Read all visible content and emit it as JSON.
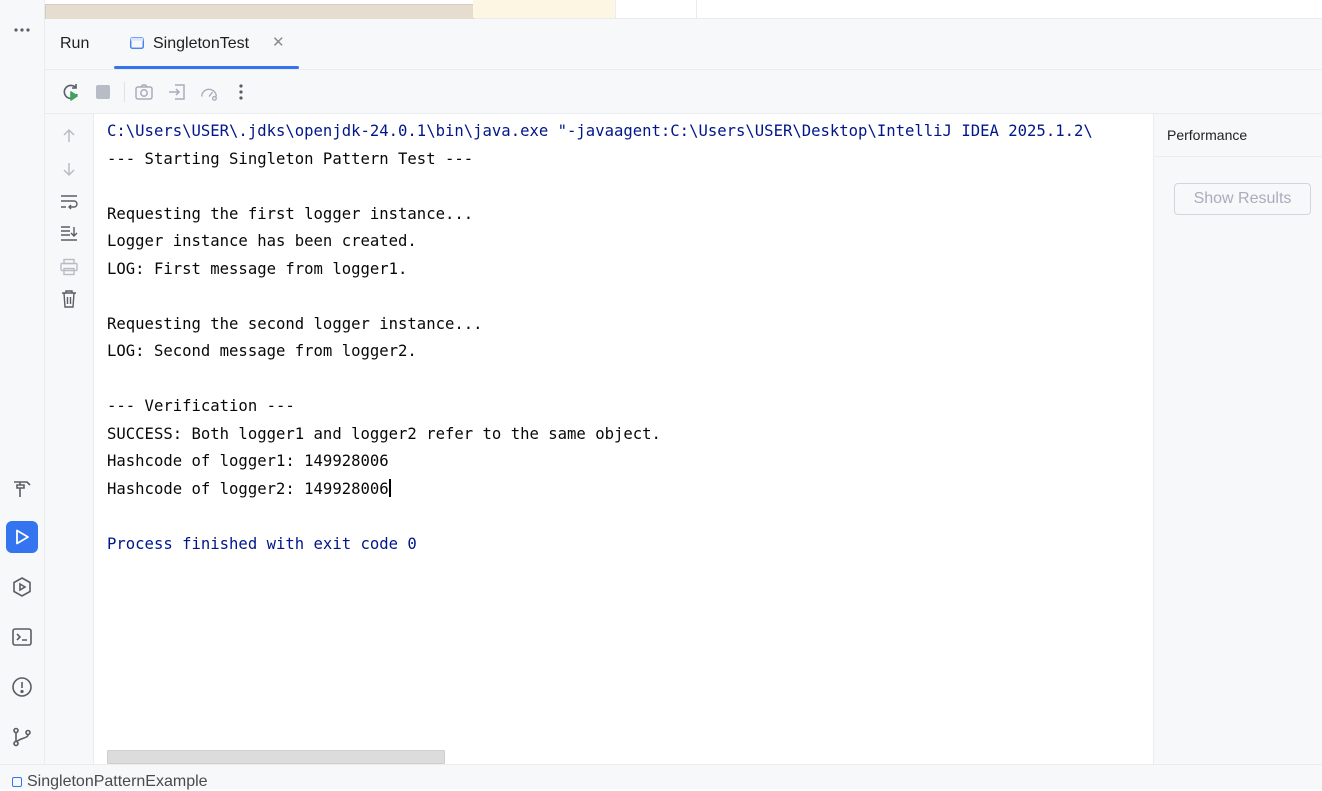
{
  "tool_window": {
    "title": "Run",
    "tab": {
      "label": "SingletonTest",
      "close_icon": "close-icon"
    }
  },
  "toolbar": {
    "buttons": [
      "rerun-icon",
      "stop-icon",
      "camera-icon",
      "restore-layout-icon",
      "profiler-icon",
      "more-vert-icon"
    ]
  },
  "console_gutter": {
    "buttons": [
      "arrow-up-icon",
      "arrow-down-icon",
      "soft-wrap-icon",
      "scroll-to-end-icon",
      "print-icon",
      "trash-icon"
    ]
  },
  "console": {
    "lines": [
      {
        "text": "C:\\Users\\USER\\.jdks\\openjdk-24.0.1\\bin\\java.exe \"-javaagent:C:\\Users\\USER\\Desktop\\IntelliJ IDEA 2025.1.2\\",
        "color": "#00168a"
      },
      {
        "text": "--- Starting Singleton Pattern Test ---",
        "color": "#080808"
      },
      {
        "text": "",
        "color": "#080808"
      },
      {
        "text": "Requesting the first logger instance...",
        "color": "#080808"
      },
      {
        "text": "Logger instance has been created.",
        "color": "#080808"
      },
      {
        "text": "LOG: First message from logger1.",
        "color": "#080808"
      },
      {
        "text": "",
        "color": "#080808"
      },
      {
        "text": "Requesting the second logger instance...",
        "color": "#080808"
      },
      {
        "text": "LOG: Second message from logger2.",
        "color": "#080808"
      },
      {
        "text": "",
        "color": "#080808"
      },
      {
        "text": "--- Verification ---",
        "color": "#080808"
      },
      {
        "text": "SUCCESS: Both logger1 and logger2 refer to the same object.",
        "color": "#080808"
      },
      {
        "text": "Hashcode of logger1: 149928006",
        "color": "#080808"
      },
      {
        "text": "Hashcode of logger2: 149928006",
        "color": "#080808"
      },
      {
        "text": "",
        "color": "#080808"
      },
      {
        "text": "Process finished with exit code 0",
        "color": "#00168a"
      }
    ]
  },
  "performance_panel": {
    "title": "Performance",
    "button_label": "Show Results"
  },
  "left_strip": {
    "more_icon": "more-horiz-icon",
    "buttons": [
      {
        "name": "build-icon",
        "active": false
      },
      {
        "name": "run-icon",
        "active": true
      },
      {
        "name": "services-icon",
        "active": false
      },
      {
        "name": "terminal-icon",
        "active": false
      },
      {
        "name": "problems-icon",
        "active": false
      },
      {
        "name": "git-icon",
        "active": false
      }
    ]
  },
  "status_bar": {
    "project": "SingletonPatternExample"
  },
  "colors": {
    "accent": "#3574f0",
    "console_blue": "#00168a"
  }
}
